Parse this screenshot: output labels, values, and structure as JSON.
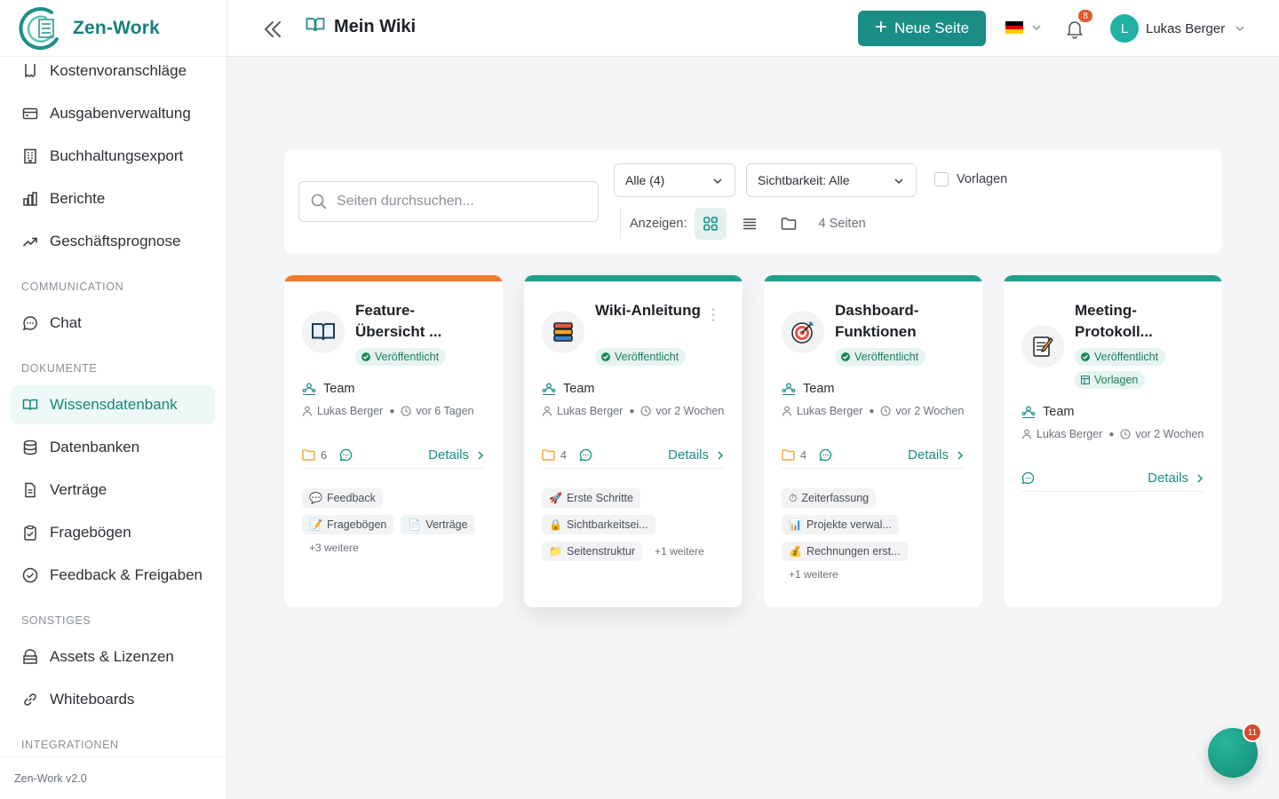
{
  "app": {
    "name": "Zen-Work",
    "version": "Zen-Work v2.0"
  },
  "sidebar": {
    "partial_item": {
      "label": "Kostenvoranschläge"
    },
    "items": [
      {
        "label": "Ausgabenverwaltung",
        "icon": "wallet-icon"
      },
      {
        "label": "Buchhaltungsexport",
        "icon": "building-icon"
      },
      {
        "label": "Berichte",
        "icon": "bar-chart-icon"
      },
      {
        "label": "Geschäftsprognose",
        "icon": "trend-icon"
      }
    ],
    "sections": {
      "communication": "COMMUNICATION",
      "dokumente": "DOKUMENTE",
      "sonstiges": "SONSTIGES",
      "integrationen": "INTEGRATIONEN"
    },
    "communication_items": [
      {
        "label": "Chat",
        "icon": "chat-icon"
      }
    ],
    "dokumente_items": [
      {
        "label": "Wissensdatenbank",
        "icon": "book-icon",
        "active": true
      },
      {
        "label": "Datenbanken",
        "icon": "database-icon"
      },
      {
        "label": "Verträge",
        "icon": "document-icon"
      },
      {
        "label": "Fragebögen",
        "icon": "clipboard-icon"
      },
      {
        "label": "Feedback & Freigaben",
        "icon": "check-circle-icon"
      }
    ],
    "sonstiges_items": [
      {
        "label": "Assets & Lizenzen",
        "icon": "box-icon"
      },
      {
        "label": "Whiteboards",
        "icon": "link-icon"
      }
    ]
  },
  "header": {
    "title": "Mein Wiki",
    "new_page_label": "Neue Seite",
    "notification_count": "8",
    "user_initial": "L",
    "user_name": "Lukas Berger"
  },
  "toolbar": {
    "search_placeholder": "Seiten durchsuchen...",
    "filter_all": "Alle (4)",
    "visibility_filter": "Sichtbarkeit: Alle",
    "templates_label": "Vorlagen",
    "view_label": "Anzeigen:",
    "page_count": "4 Seiten"
  },
  "cards": [
    {
      "title": "Feature-Übersicht ...",
      "icon": "book-icon",
      "bar_color": "#f47a2c",
      "status": "Veröffentlicht",
      "visibility": "Team",
      "author": "Lukas Berger",
      "time": "vor 6 Tagen",
      "folder_count": "6",
      "details_label": "Details",
      "tags": [
        {
          "icon": "💬",
          "label": "Feedback"
        },
        {
          "icon": "📝",
          "label": "Fragebögen"
        },
        {
          "icon": "📄",
          "label": "Verträge"
        }
      ],
      "more": "+3 weitere"
    },
    {
      "title": "Wiki-Anleitung",
      "icon": "books-icon",
      "bar_color": "#1fa08d",
      "status": "Veröffentlicht",
      "visibility": "Team",
      "author": "Lukas Berger",
      "time": "vor 2 Wochen",
      "folder_count": "4",
      "details_label": "Details",
      "tags": [
        {
          "icon": "🚀",
          "label": "Erste Schritte"
        },
        {
          "icon": "🔒",
          "label": "Sichtbarkeitsei..."
        },
        {
          "icon": "📁",
          "label": "Seitenstruktur"
        }
      ],
      "more": "+1 weitere"
    },
    {
      "title": "Dashboard-Funktionen",
      "icon": "target-icon",
      "bar_color": "#1fa08d",
      "status": "Veröffentlicht",
      "visibility": "Team",
      "author": "Lukas Berger",
      "time": "vor 2 Wochen",
      "folder_count": "4",
      "details_label": "Details",
      "tags": [
        {
          "icon": "⏱",
          "label": "Zeiterfassung"
        },
        {
          "icon": "📊",
          "label": "Projekte verwal..."
        },
        {
          "icon": "💰",
          "label": "Rechnungen erst..."
        }
      ],
      "more": "+1 weitere"
    },
    {
      "title": "Meeting-Protokoll...",
      "icon": "memo-icon",
      "bar_color": "#1fa08d",
      "status": "Veröffentlicht",
      "template_badge": "Vorlagen",
      "visibility": "Team",
      "author": "Lukas Berger",
      "time": "vor 2 Wochen",
      "details_label": "Details"
    }
  ],
  "fab": {
    "badge": "11"
  },
  "colors": {
    "accent": "#1a8d85",
    "orange": "#f47a2c",
    "badge_red": "#e4572e"
  }
}
